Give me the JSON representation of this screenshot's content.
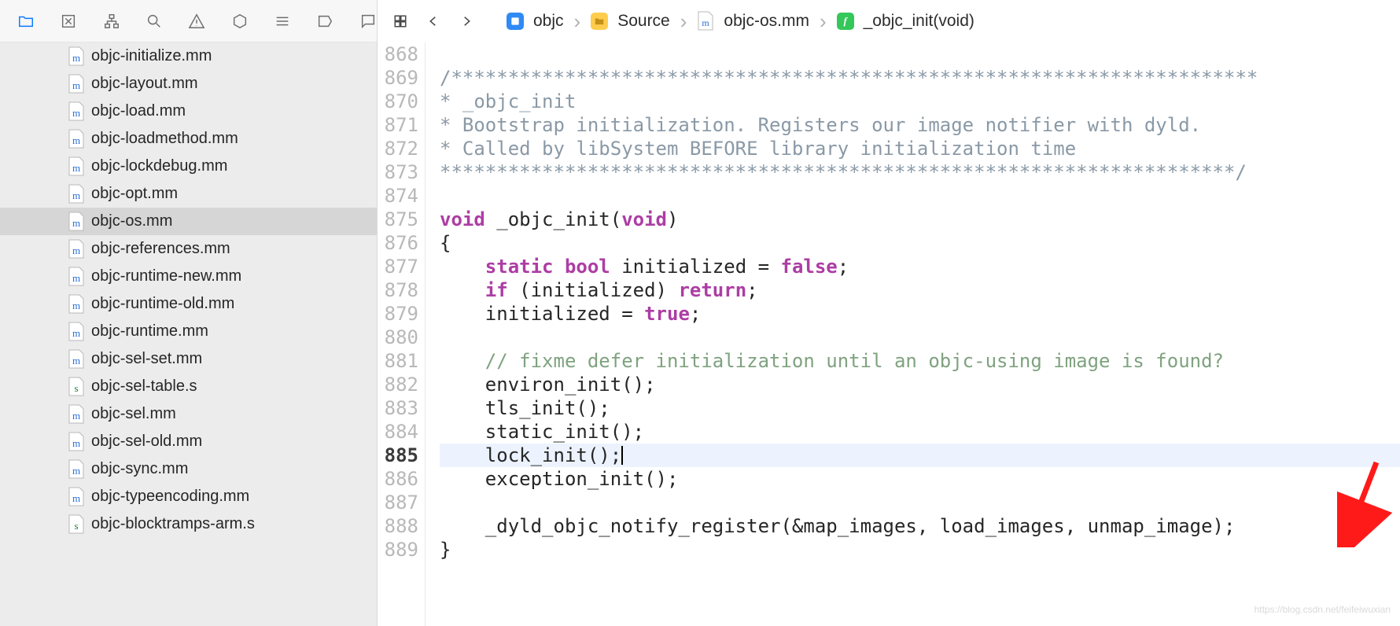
{
  "toolbar_icons": [
    "folder",
    "xbox",
    "hierarchy",
    "search",
    "warning",
    "hexagon",
    "lines",
    "tag",
    "speech"
  ],
  "files": [
    {
      "name": "objc-initialize.mm",
      "ext": "mm"
    },
    {
      "name": "objc-layout.mm",
      "ext": "mm"
    },
    {
      "name": "objc-load.mm",
      "ext": "mm"
    },
    {
      "name": "objc-loadmethod.mm",
      "ext": "mm"
    },
    {
      "name": "objc-lockdebug.mm",
      "ext": "mm"
    },
    {
      "name": "objc-opt.mm",
      "ext": "mm"
    },
    {
      "name": "objc-os.mm",
      "ext": "mm",
      "selected": true
    },
    {
      "name": "objc-references.mm",
      "ext": "mm"
    },
    {
      "name": "objc-runtime-new.mm",
      "ext": "mm"
    },
    {
      "name": "objc-runtime-old.mm",
      "ext": "mm"
    },
    {
      "name": "objc-runtime.mm",
      "ext": "mm"
    },
    {
      "name": "objc-sel-set.mm",
      "ext": "mm"
    },
    {
      "name": "objc-sel-table.s",
      "ext": "s"
    },
    {
      "name": "objc-sel.mm",
      "ext": "mm"
    },
    {
      "name": "objc-sel-old.mm",
      "ext": "mm"
    },
    {
      "name": "objc-sync.mm",
      "ext": "mm"
    },
    {
      "name": "objc-typeencoding.mm",
      "ext": "mm"
    },
    {
      "name": "objc-blocktramps-arm.s",
      "ext": "s"
    }
  ],
  "breadcrumb": {
    "project": "objc",
    "folder": "Source",
    "file": "objc-os.mm",
    "symbol": "_objc_init(void)"
  },
  "code": {
    "first_line": 868,
    "active_line": 885,
    "lines": [
      {
        "n": 868,
        "segs": []
      },
      {
        "n": 869,
        "segs": [
          {
            "t": "/***********************************************************************",
            "c": "cmt"
          }
        ]
      },
      {
        "n": 870,
        "segs": [
          {
            "t": "* _objc_init",
            "c": "cmt"
          }
        ]
      },
      {
        "n": 871,
        "segs": [
          {
            "t": "* Bootstrap initialization. Registers our image notifier with dyld.",
            "c": "cmt"
          }
        ]
      },
      {
        "n": 872,
        "segs": [
          {
            "t": "* Called by libSystem BEFORE library initialization time",
            "c": "cmt"
          }
        ]
      },
      {
        "n": 873,
        "segs": [
          {
            "t": "**********************************************************************/",
            "c": "cmt"
          }
        ]
      },
      {
        "n": 874,
        "segs": []
      },
      {
        "n": 875,
        "segs": [
          {
            "t": "void",
            "c": "kw"
          },
          {
            "t": " _objc_init("
          },
          {
            "t": "void",
            "c": "kw"
          },
          {
            "t": ")"
          }
        ]
      },
      {
        "n": 876,
        "segs": [
          {
            "t": "{"
          }
        ]
      },
      {
        "n": 877,
        "segs": [
          {
            "t": "    "
          },
          {
            "t": "static",
            "c": "kw"
          },
          {
            "t": " "
          },
          {
            "t": "bool",
            "c": "kw"
          },
          {
            "t": " initialized = "
          },
          {
            "t": "false",
            "c": "kw"
          },
          {
            "t": ";"
          }
        ]
      },
      {
        "n": 878,
        "segs": [
          {
            "t": "    "
          },
          {
            "t": "if",
            "c": "kw"
          },
          {
            "t": " (initialized) "
          },
          {
            "t": "return",
            "c": "kw"
          },
          {
            "t": ";"
          }
        ]
      },
      {
        "n": 879,
        "segs": [
          {
            "t": "    initialized = "
          },
          {
            "t": "true",
            "c": "kw"
          },
          {
            "t": ";"
          }
        ]
      },
      {
        "n": 880,
        "segs": []
      },
      {
        "n": 881,
        "segs": [
          {
            "t": "    "
          },
          {
            "t": "// fixme defer initialization until an objc-using image is found?",
            "c": "cmtg"
          }
        ]
      },
      {
        "n": 882,
        "segs": [
          {
            "t": "    environ_init();"
          }
        ]
      },
      {
        "n": 883,
        "segs": [
          {
            "t": "    tls_init();"
          }
        ]
      },
      {
        "n": 884,
        "segs": [
          {
            "t": "    static_init();"
          }
        ]
      },
      {
        "n": 885,
        "segs": [
          {
            "t": "    lock_init();"
          }
        ],
        "caret": true,
        "hl": true
      },
      {
        "n": 886,
        "segs": [
          {
            "t": "    exception_init();"
          }
        ]
      },
      {
        "n": 887,
        "segs": []
      },
      {
        "n": 888,
        "segs": [
          {
            "t": "    _dyld_objc_notify_register(&map_images, load_images, unmap_image);"
          }
        ]
      },
      {
        "n": 889,
        "segs": [
          {
            "t": "}"
          }
        ]
      }
    ]
  },
  "watermark": "https://blog.csdn.net/feifeiwuxian"
}
